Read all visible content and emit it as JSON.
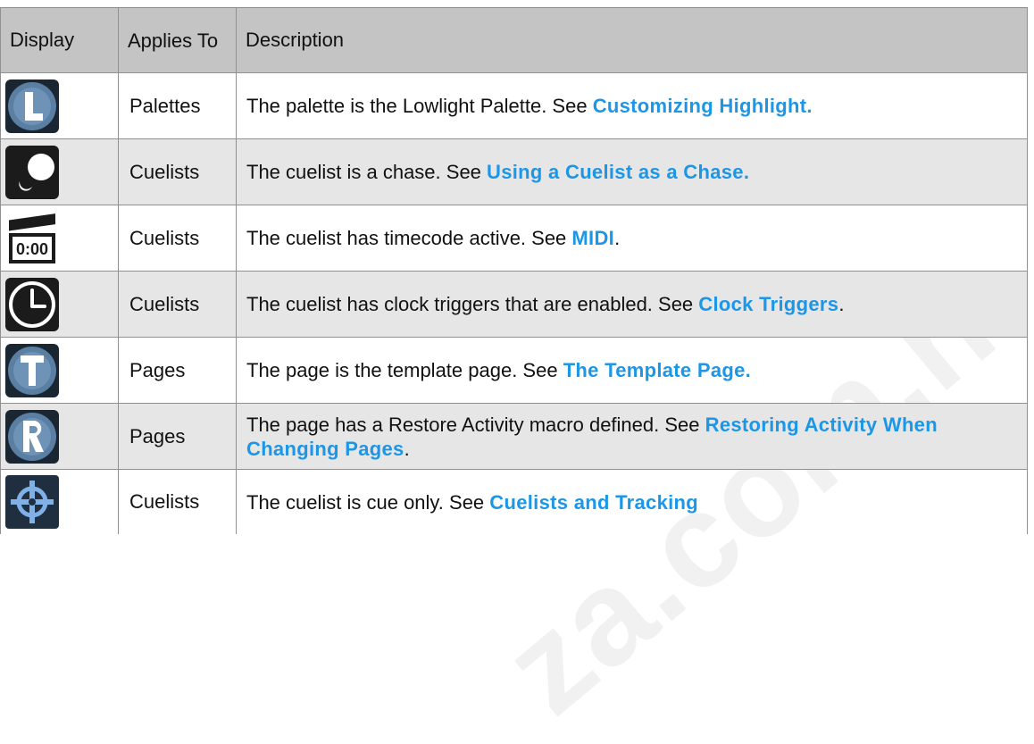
{
  "header": {
    "display": "Display",
    "applies_to": "Applies To",
    "description": "Description"
  },
  "rows": [
    {
      "icon": "lowlight-palette-icon",
      "applies": "Palettes",
      "text": "The palette is the Lowlight Palette. See ",
      "link": "Customizing Highlight.",
      "after": ""
    },
    {
      "icon": "chase-icon",
      "applies": "Cuelists",
      "text": "The cuelist is a chase. See ",
      "link": "Using a Cuelist as a Chase.",
      "after": ""
    },
    {
      "icon": "timecode-icon",
      "icon_text": "0:00",
      "applies": "Cuelists",
      "text": "The cuelist has timecode active. See ",
      "link": "MIDI",
      "after": "."
    },
    {
      "icon": "clock-icon",
      "applies": "Cuelists",
      "text": "The cuelist has clock triggers that are enabled. See ",
      "link": "Clock Triggers",
      "after": "."
    },
    {
      "icon": "template-page-icon",
      "applies": "Pages",
      "text": "The page is the template page. See ",
      "link": "The Template Page.",
      "after": ""
    },
    {
      "icon": "restore-activity-icon",
      "applies": "Pages",
      "text": "The page has a Restore Activity macro defined. See ",
      "link": "Restoring Activity When Changing Pages",
      "after": "."
    },
    {
      "icon": "cue-only-icon",
      "applies": "Cuelists",
      "text": "The cuelist is cue only. See ",
      "link": "Cuelists and Tracking",
      "after": ""
    }
  ],
  "watermark": "za.com.n",
  "colors": {
    "link": "#1c96e6",
    "header_bg": "#c4c4c4",
    "shade_bg": "#e6e6e6",
    "icon_bg": "#4a6d8e"
  }
}
